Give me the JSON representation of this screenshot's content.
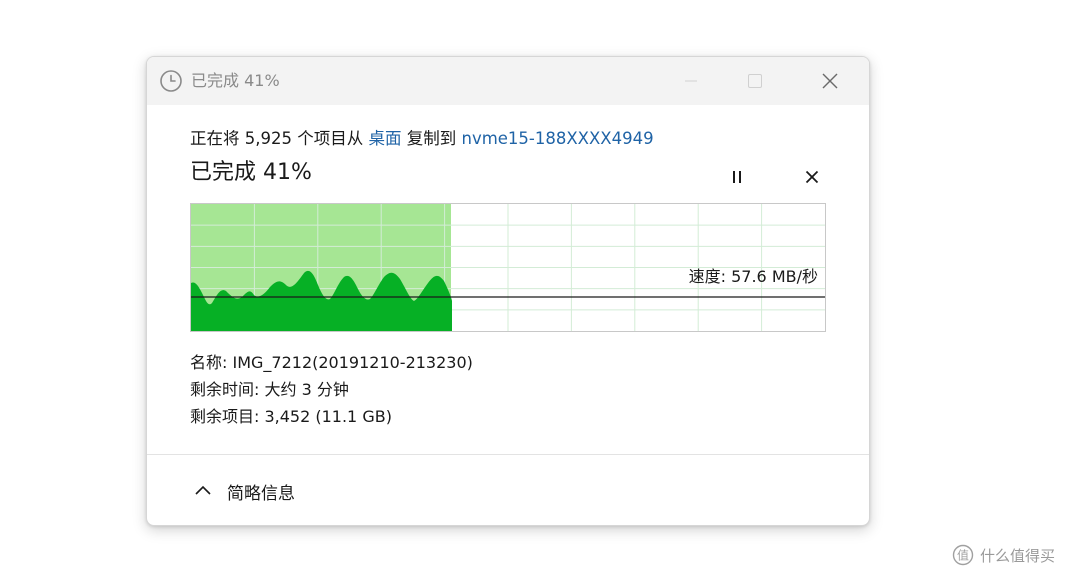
{
  "window": {
    "title": "已完成 41%",
    "icon": "clock-icon"
  },
  "copy_status": {
    "prefix": "正在将 5,925 个项目从 ",
    "source": "桌面",
    "middle": " 复制到 ",
    "destination": "nvme15-188XXXX4949"
  },
  "progress": {
    "label": "已完成 41%",
    "percent": 41
  },
  "controls": {
    "pause_icon": "pause-icon",
    "cancel_icon": "close-icon"
  },
  "speed": {
    "label": "速度: 57.6 MB/秒"
  },
  "details": {
    "name": "名称: IMG_7212(20191210-213230)",
    "time_remaining": "剩余时间: 大约 3 分钟",
    "items_remaining": "剩余项目: 3,452 (11.1 GB)"
  },
  "footer": {
    "toggle_label": "简略信息",
    "toggle_icon": "chevron-up-icon"
  },
  "watermark": {
    "text": "什么值得买"
  },
  "colors": {
    "progress_fill": "#a6e694",
    "speed_fill": "#06b025",
    "link": "#1f63a6",
    "grid": "#d3ecd6"
  }
}
